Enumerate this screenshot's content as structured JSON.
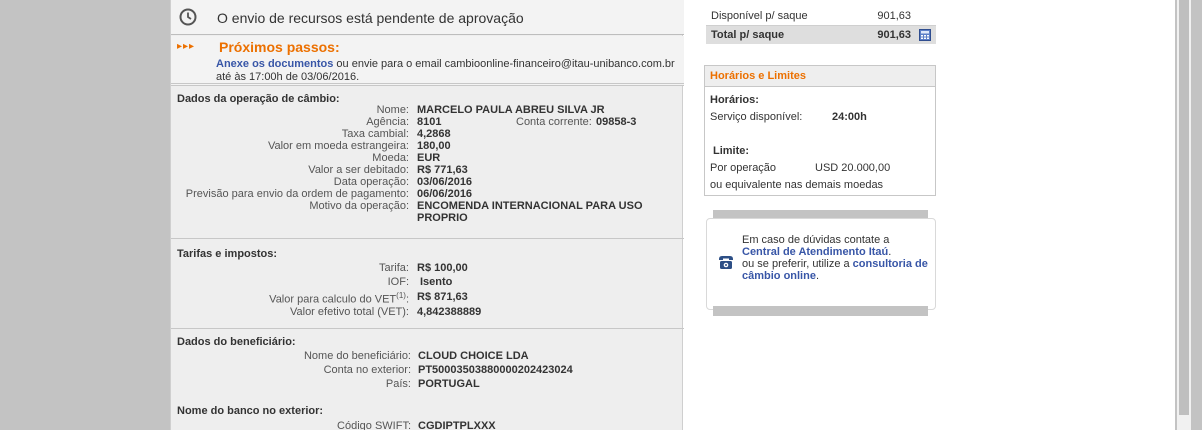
{
  "status": {
    "text": "O envio de recursos está pendente de aprovação",
    "icon": "clock-icon"
  },
  "next_steps": {
    "arrows": "▸▸▸",
    "title": "Próximos passos:",
    "link": "Anexe os documentos",
    "line1_rest": " ou envie para o email cambioonline-financeiro@itau-unibanco.com.br",
    "line2": "até às 17:00h de 03/06/2016."
  },
  "operation": {
    "title": "Dados da operação de câmbio:",
    "nome_label": "Nome:",
    "nome": "MARCELO PAULA ABREU SILVA JR",
    "agencia_label": "Agência:",
    "agencia": "8101",
    "conta_label": "Conta corrente:",
    "conta": "09858-3",
    "taxa_label": "Taxa cambial:",
    "taxa": "4,2868",
    "valor_moeda_label": "Valor em moeda estrangeira:",
    "valor_moeda": "180,00",
    "moeda_label": "Moeda:",
    "moeda": "EUR",
    "debitado_label": "Valor a ser debitado:",
    "debitado": "R$ 771,63",
    "data_label": "Data operação:",
    "data": "03/06/2016",
    "previsao_label": "Previsão para envio da ordem de pagamento:",
    "previsao": "06/06/2016",
    "motivo_label": "Motivo da operação:",
    "motivo": "ENCOMENDA INTERNACIONAL PARA USO PROPRIO"
  },
  "tarifas": {
    "title": "Tarifas e impostos:",
    "tarifa_label": "Tarifa:",
    "tarifa": "R$ 100,00",
    "iof_label": "IOF:",
    "iof": "Isento",
    "vet_calc_label": "Valor para calculo do VET",
    "vet_sup": "(1)",
    "vet_colon": ":",
    "vet_calc": "R$ 871,63",
    "vet_total_label": "Valor efetivo total (VET):",
    "vet_total": "4,842388889"
  },
  "beneficiario": {
    "title": "Dados do beneficiário:",
    "nome_label": "Nome do beneficiário:",
    "nome": "CLOUD CHOICE LDA",
    "conta_label": "Conta no exterior:",
    "conta": "PT50003503880000202423024",
    "pais_label": "País:",
    "pais": "PORTUGAL"
  },
  "banco": {
    "title": "Nome do banco no exterior:",
    "swift_label": "Código SWIFT:",
    "swift": "CGDIPTPLXXX"
  },
  "summary": {
    "disp_label": "Disponível p/ saque",
    "disp_value": "901,63",
    "total_label": "Total p/ saque",
    "total_value": "901,63"
  },
  "limits": {
    "title": "Horários e Limites",
    "horarios_label": "Horários:",
    "servico_label": "Serviço disponível:",
    "servico_value": "24:00h",
    "limite_label": "Limite:",
    "por_op_label": "Por operação",
    "por_op_value": "USD 20.000,00",
    "equiv": "ou equivalente nas demais moedas"
  },
  "help": {
    "line1": "Em caso de dúvidas contate a",
    "link1": "Central de Atendimento Itaú",
    "link1_end": ".",
    "line3": "ou se preferir, utilize a ",
    "link2a": "consultoria de",
    "link2b": "câmbio online",
    "link2_end": "."
  },
  "colors": {
    "accent": "#ec7000",
    "link": "#3856a7",
    "side": "#c3c3c3"
  }
}
